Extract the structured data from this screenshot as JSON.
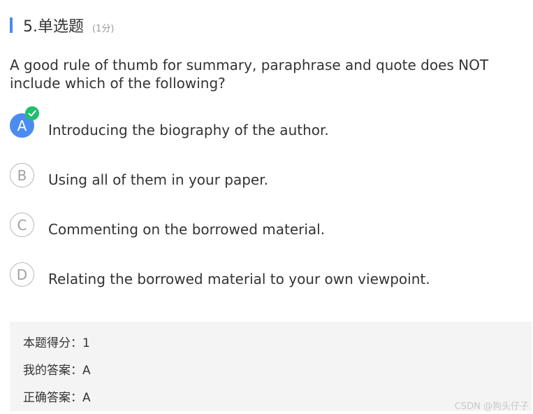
{
  "header": {
    "title": "5.单选题",
    "score": "(1分)",
    "accent_color": "#4a8cf0"
  },
  "question": {
    "text": "A good rule of thumb for summary, paraphrase and quote does NOT include which of the following?"
  },
  "options": [
    {
      "letter": "A",
      "text": "Introducing the biography of the author.",
      "selected": true,
      "correct": true
    },
    {
      "letter": "B",
      "text": "Using all of them in your paper.",
      "selected": false
    },
    {
      "letter": "C",
      "text": "Commenting on the borrowed material.",
      "selected": false
    },
    {
      "letter": "D",
      "text": "Relating the borrowed material to your own viewpoint.",
      "selected": false
    }
  ],
  "icons": {
    "correct_check": "check-icon",
    "check_color": "#1fbf6d"
  },
  "result": {
    "score_line": "本题得分：1",
    "my_answer_line": "我的答案：A",
    "correct_answer_line": "正确答案：A"
  },
  "watermark": "CSDN @狗头仔子"
}
